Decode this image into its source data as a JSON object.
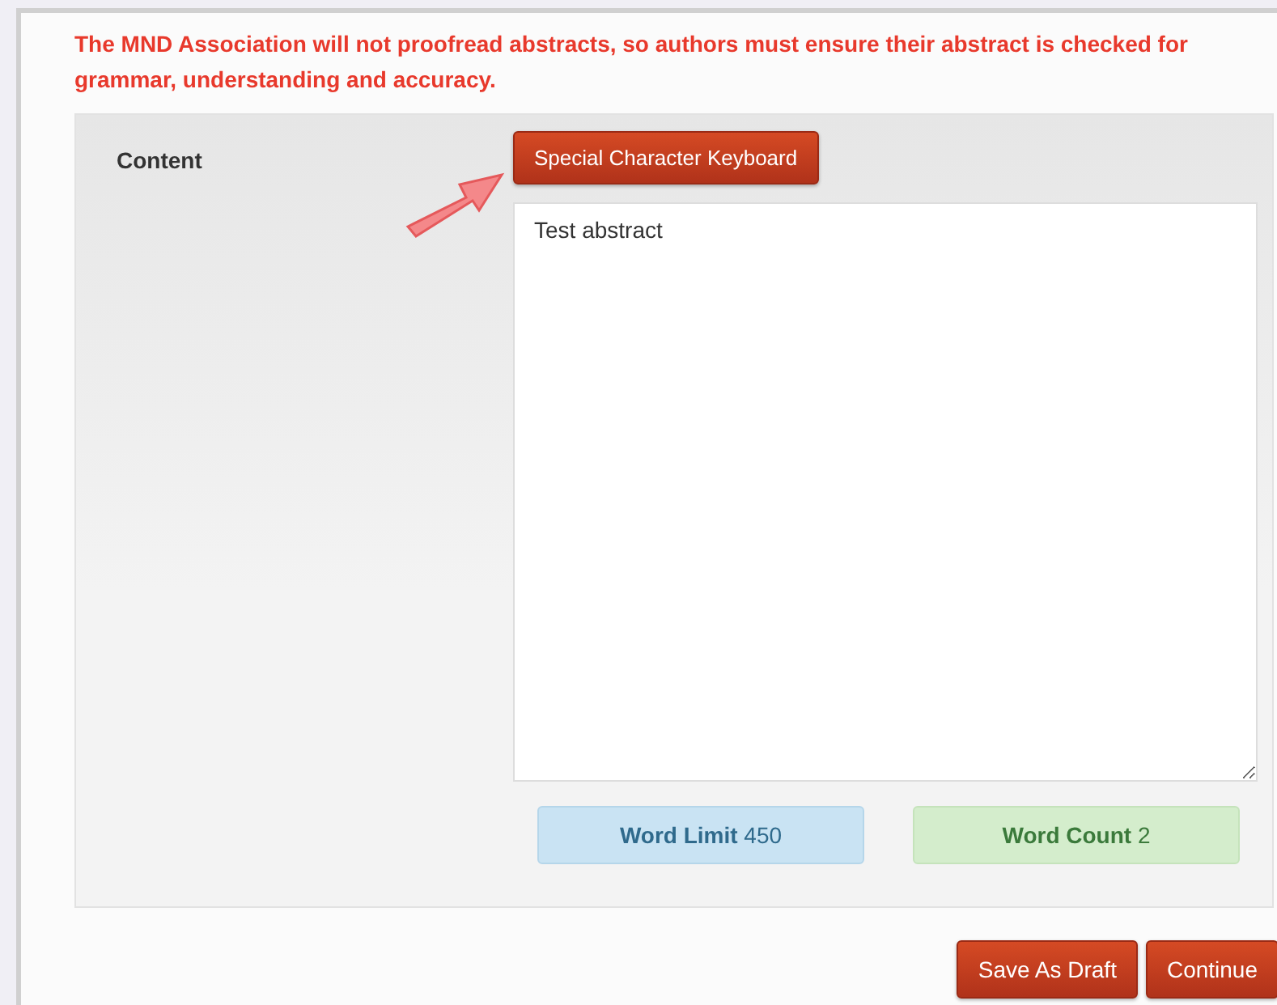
{
  "notice": "The MND Association will not proofread abstracts, so authors must ensure their abstract is checked for grammar, understanding and accuracy.",
  "content": {
    "label": "Content",
    "keyboard_button": "Special Character Keyboard",
    "abstract": {
      "value": "Test abstract"
    },
    "counters": [
      {
        "kind": "limit",
        "text": "**Word Limit** 450"
      },
      {
        "kind": "count",
        "text": "**Word Count** 2"
      }
    ]
  },
  "buttons": [
    "Save As Draft",
    "Continue"
  ]
}
